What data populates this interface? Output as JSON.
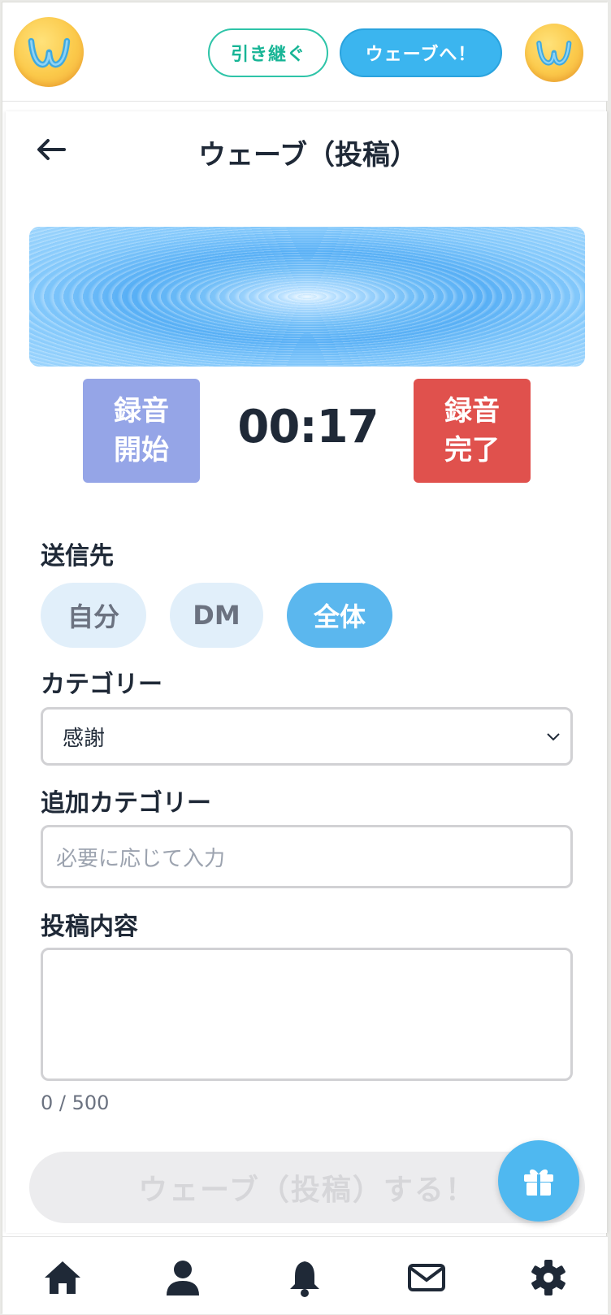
{
  "header": {
    "logo_icon": "w-logo-icon",
    "hikitsugi_label": "引き継ぐ",
    "wave_label": "ウェーブへ！",
    "avatar_icon": "w-logo-avatar-icon"
  },
  "page": {
    "back_icon": "arrow-left-icon",
    "title": "ウェーブ（投稿）"
  },
  "recorder": {
    "start_line1": "録音",
    "start_line2": "開始",
    "timer": "00:17",
    "finish_line1": "録音",
    "finish_line2": "完了"
  },
  "form": {
    "destination_label": "送信先",
    "destinations": [
      {
        "label": "自分",
        "selected": false
      },
      {
        "label": "DM",
        "selected": false
      },
      {
        "label": "全体",
        "selected": true
      }
    ],
    "category_label": "カテゴリー",
    "category_value": "感謝",
    "extra_category_label": "追加カテゴリー",
    "extra_category_placeholder": "必要に応じて入力",
    "content_label": "投稿内容",
    "content_value": "",
    "char_counter": "0 / 500",
    "submit_label": "ウェーブ（投稿）する！"
  },
  "fab": {
    "icon": "gift-icon"
  },
  "bottom_nav": [
    {
      "icon": "home-icon"
    },
    {
      "icon": "user-icon"
    },
    {
      "icon": "bell-icon"
    },
    {
      "icon": "mail-icon"
    },
    {
      "icon": "gear-icon"
    }
  ],
  "colors": {
    "accent_blue": "#3bb5ef",
    "chip_selected": "#5bb7ee",
    "chip_unselected": "#e1effa",
    "rec_start": "#95a5e7",
    "rec_finish": "#e0514d",
    "teal": "#2ec4a8"
  }
}
